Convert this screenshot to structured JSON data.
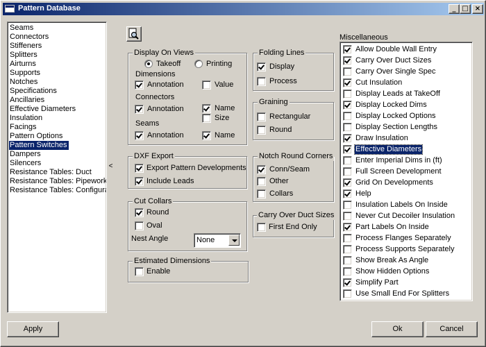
{
  "window": {
    "title": "Pattern Database"
  },
  "titlebar_buttons": {
    "minimize": "_",
    "maximize": "□",
    "close": "×"
  },
  "sidebar": {
    "items": [
      {
        "label": "Seams",
        "selected": false
      },
      {
        "label": "Connectors",
        "selected": false
      },
      {
        "label": "Stiffeners",
        "selected": false
      },
      {
        "label": "Splitters",
        "selected": false
      },
      {
        "label": "Airturns",
        "selected": false
      },
      {
        "label": "Supports",
        "selected": false
      },
      {
        "label": "Notches",
        "selected": false
      },
      {
        "label": "Specifications",
        "selected": false
      },
      {
        "label": "Ancillaries",
        "selected": false
      },
      {
        "label": "Effective Diameters",
        "selected": false
      },
      {
        "label": "Insulation",
        "selected": false
      },
      {
        "label": "Facings",
        "selected": false
      },
      {
        "label": "Pattern Options",
        "selected": false
      },
      {
        "label": "Pattern Switches",
        "selected": true
      },
      {
        "label": "Dampers",
        "selected": false
      },
      {
        "label": "Silencers",
        "selected": false
      },
      {
        "label": "Resistance Tables: Duct",
        "selected": false
      },
      {
        "label": "Resistance Tables: Pipework",
        "selected": false
      },
      {
        "label": "Resistance Tables: Configura",
        "selected": false
      }
    ]
  },
  "splitter": {
    "arrow": "<"
  },
  "display_on_views": {
    "title": "Display On Views",
    "takeoff": {
      "label": "Takeoff",
      "checked": true
    },
    "printing": {
      "label": "Printing",
      "checked": false
    },
    "dimensions_label": "Dimensions",
    "dim_annotation": {
      "label": "Annotation",
      "checked": true
    },
    "dim_value": {
      "label": "Value",
      "checked": false
    },
    "connectors_label": "Connectors",
    "conn_annotation": {
      "label": "Annotation",
      "checked": true
    },
    "conn_name": {
      "label": "Name",
      "checked": true
    },
    "conn_size": {
      "label": "Size",
      "checked": false
    },
    "seams_label": "Seams",
    "seams_annotation": {
      "label": "Annotation",
      "checked": true
    },
    "seams_name": {
      "label": "Name",
      "checked": true
    }
  },
  "folding_lines": {
    "title": "Folding Lines",
    "display": {
      "label": "Display",
      "checked": true
    },
    "process": {
      "label": "Process",
      "checked": false
    }
  },
  "graining": {
    "title": "Graining",
    "rectangular": {
      "label": "Rectangular",
      "checked": false
    },
    "round": {
      "label": "Round",
      "checked": false
    }
  },
  "dxf_export": {
    "title": "DXF Export",
    "export_pattern": {
      "label": "Export Pattern Developments",
      "checked": true
    },
    "include_leads": {
      "label": "Include Leads",
      "checked": true
    }
  },
  "notch_round_corners": {
    "title": "Notch Round Corners",
    "conn_seam": {
      "label": "Conn/Seam",
      "checked": true
    },
    "other": {
      "label": "Other",
      "checked": false
    },
    "collars": {
      "label": "Collars",
      "checked": false
    }
  },
  "cut_collars": {
    "title": "Cut Collars",
    "round": {
      "label": "Round",
      "checked": true
    },
    "oval": {
      "label": "Oval",
      "checked": false
    },
    "nest_angle_label": "Nest Angle",
    "nest_angle_value": "None"
  },
  "carry_over_duct_sizes": {
    "title": "Carry Over Duct Sizes",
    "first_end_only": {
      "label": "First End Only",
      "checked": false
    }
  },
  "estimated_dimensions": {
    "title": "Estimated Dimensions",
    "enable": {
      "label": "Enable",
      "checked": false
    }
  },
  "miscellaneous": {
    "title": "Miscellaneous",
    "items": [
      {
        "label": "Allow Double Wall Entry",
        "checked": true,
        "selected": false
      },
      {
        "label": "Carry Over Duct Sizes",
        "checked": true,
        "selected": false
      },
      {
        "label": "Carry Over Single Spec",
        "checked": false,
        "selected": false
      },
      {
        "label": "Cut Insulation",
        "checked": true,
        "selected": false
      },
      {
        "label": "Display Leads at TakeOff",
        "checked": false,
        "selected": false
      },
      {
        "label": "Display Locked Dims",
        "checked": true,
        "selected": false
      },
      {
        "label": "Display Locked Options",
        "checked": false,
        "selected": false
      },
      {
        "label": "Display Section Lengths",
        "checked": false,
        "selected": false
      },
      {
        "label": "Draw Insulation",
        "checked": true,
        "selected": false
      },
      {
        "label": "Effective Diameters",
        "checked": true,
        "selected": true
      },
      {
        "label": "Enter Imperial Dims in (ft)",
        "checked": false,
        "selected": false
      },
      {
        "label": "Full Screen Development",
        "checked": false,
        "selected": false
      },
      {
        "label": "Grid On Developments",
        "checked": true,
        "selected": false
      },
      {
        "label": "Help",
        "checked": true,
        "selected": false
      },
      {
        "label": "Insulation Labels On Inside",
        "checked": false,
        "selected": false
      },
      {
        "label": "Never Cut Decoiler Insulation",
        "checked": false,
        "selected": false
      },
      {
        "label": "Part Labels On Inside",
        "checked": true,
        "selected": false
      },
      {
        "label": "Process Flanges Separately",
        "checked": false,
        "selected": false
      },
      {
        "label": "Process Supports Separately",
        "checked": false,
        "selected": false
      },
      {
        "label": "Show Break As Angle",
        "checked": false,
        "selected": false
      },
      {
        "label": "Show Hidden Options",
        "checked": false,
        "selected": false
      },
      {
        "label": "Simplify Part",
        "checked": true,
        "selected": false
      },
      {
        "label": "Use Small End For Splitters",
        "checked": false,
        "selected": false
      }
    ]
  },
  "footer": {
    "apply_label": "Apply",
    "ok_label": "Ok",
    "cancel_label": "Cancel"
  },
  "icons": {
    "preview": "magnifier-page-icon"
  }
}
